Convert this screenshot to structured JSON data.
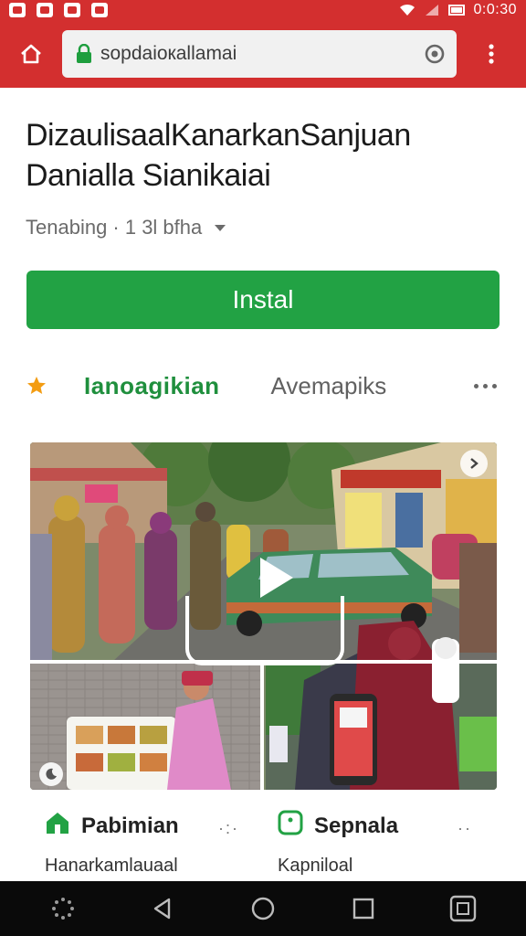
{
  "status_bar": {
    "time": "0:0:30",
    "notification_icons": [
      "notification-icon",
      "notification-icon",
      "notification-icon",
      "notification-icon"
    ],
    "system_icons": [
      "wifi-icon",
      "signal-icon",
      "battery-icon"
    ]
  },
  "toolbar": {
    "url": "sopdaioкallamai",
    "home_icon": "home-icon",
    "lock_icon": "lock-icon",
    "reload_icon": "reload-icon",
    "menu_icon": "overflow-menu-icon"
  },
  "app": {
    "title": "DizaulisaalKanarkanSanjuan Danialla Sianikaiai",
    "meta": "Tenabing · 1 3l bfha",
    "install_label": "Instal"
  },
  "tabs": {
    "items": [
      "Ianoagikian",
      "Avemapiks"
    ],
    "active_index": 0
  },
  "cards": [
    {
      "title": "Pabimian",
      "subtitle": "Hanarkamlauaal",
      "more": "·:·",
      "icon": "home-icon",
      "color": "#22a244"
    },
    {
      "title": "Sepnala",
      "subtitle": "Kapniloal",
      "more": "··",
      "icon": "app-icon",
      "color": "#22a244"
    }
  ],
  "colors": {
    "header": "#d32f2f",
    "install": "#22a244",
    "active_tab": "#1f8f3d",
    "star": "#f39c12"
  }
}
